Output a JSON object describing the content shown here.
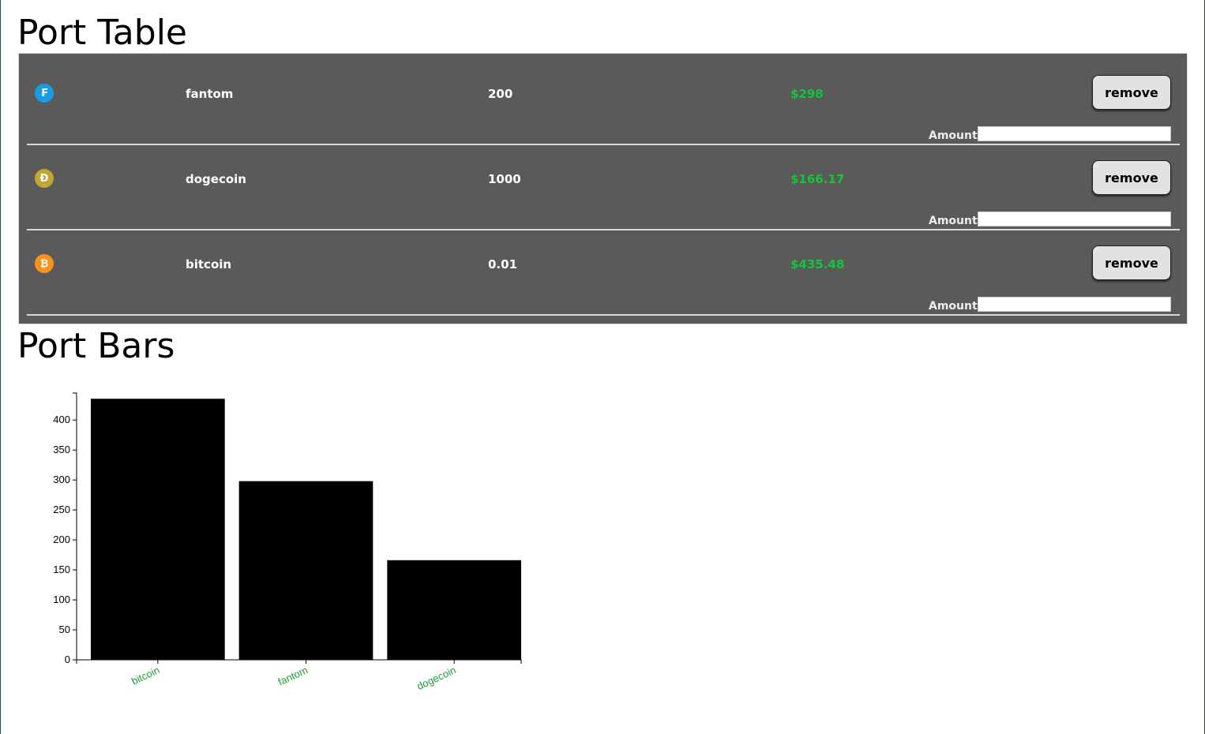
{
  "headings": {
    "table": "Port Table",
    "bars": "Port Bars"
  },
  "rows": [
    {
      "icon": "fantom-icon",
      "icon_glyph": "₣",
      "icon_color": "#1a9be6",
      "name": "fantom",
      "amount": "200",
      "value": "$298",
      "button": "remove",
      "amount_label": "Amount:",
      "input_value": ""
    },
    {
      "icon": "dogecoin-icon",
      "icon_glyph": "Ð",
      "icon_color": "#c2a633",
      "name": "dogecoin",
      "amount": "1000",
      "value": "$166.17",
      "button": "remove",
      "amount_label": "Amount:",
      "input_value": ""
    },
    {
      "icon": "bitcoin-icon",
      "icon_glyph": "₿",
      "icon_color": "#f7931a",
      "name": "bitcoin",
      "amount": "0.01",
      "value": "$435.48",
      "button": "remove",
      "amount_label": "Amount:",
      "input_value": ""
    }
  ],
  "colors": {
    "table_bg": "#595a59",
    "value_text": "#12c53a",
    "bar_fill": "#000000",
    "x_tick_label": "#1aa13c"
  },
  "chart_data": {
    "type": "bar",
    "categories": [
      "bitcoin",
      "fantom",
      "dogecoin"
    ],
    "values": [
      435.48,
      298,
      166.17
    ],
    "title": "",
    "xlabel": "",
    "ylabel": "",
    "ylim": [
      0,
      445
    ],
    "yticks": [
      0,
      50,
      100,
      150,
      200,
      250,
      300,
      350,
      400
    ],
    "grid": false
  }
}
